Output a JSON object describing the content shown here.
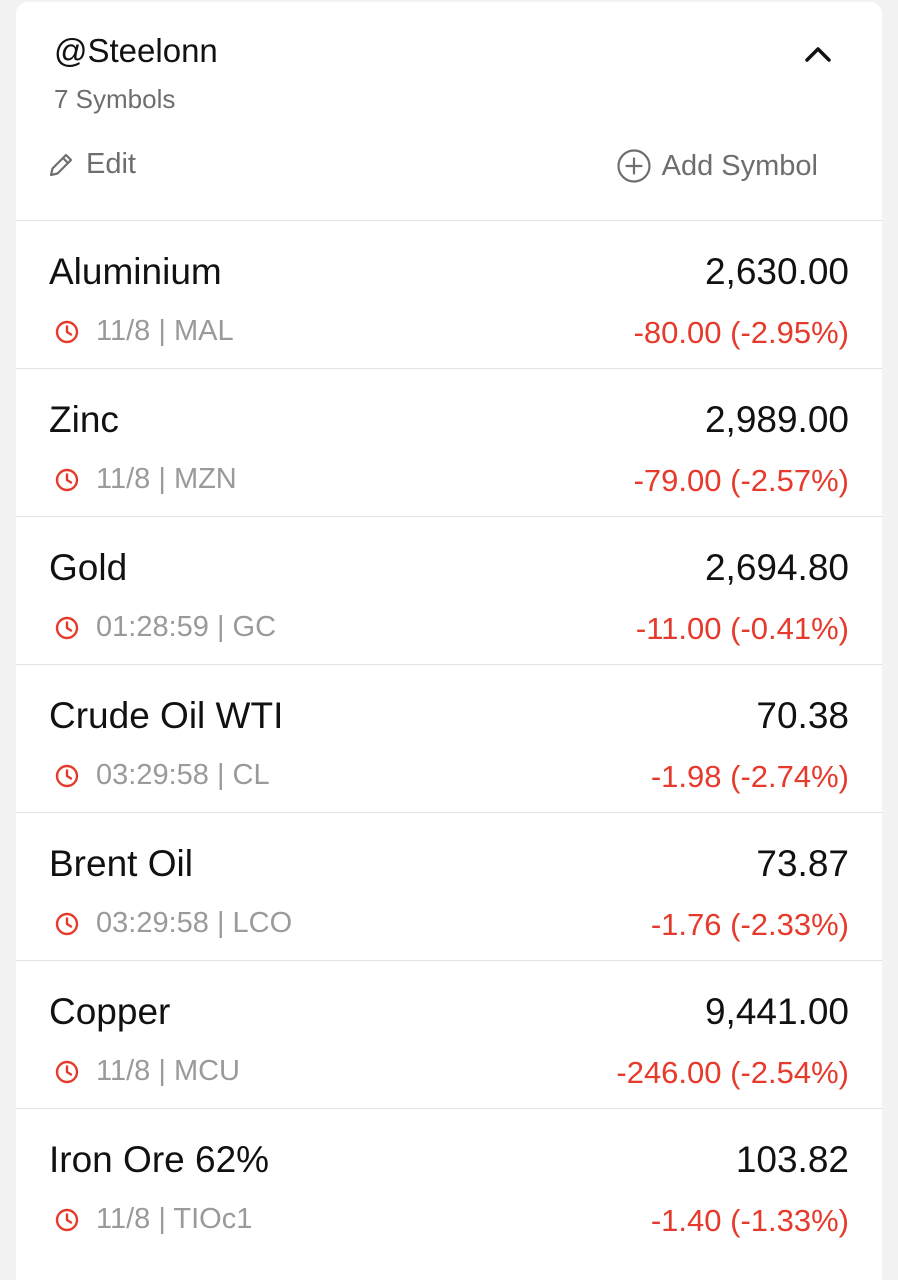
{
  "watchlist": {
    "title": "@Steelonn",
    "count_label": "7 Symbols",
    "edit_label": "Edit",
    "add_label": "Add Symbol"
  },
  "colors": {
    "negative": "#e53a2c",
    "muted": "#9a9a9a",
    "text": "#111111"
  },
  "icons": {
    "collapse": "chevron-up-icon",
    "edit": "pencil-icon",
    "add": "plus-circle-icon",
    "time": "clock-icon"
  },
  "symbols": [
    {
      "name": "Aluminium",
      "price": "2,630.00",
      "time": "11/8",
      "ticker": "MAL",
      "change": "-80.00 (-2.95%)"
    },
    {
      "name": "Zinc",
      "price": "2,989.00",
      "time": "11/8",
      "ticker": "MZN",
      "change": "-79.00 (-2.57%)"
    },
    {
      "name": "Gold",
      "price": "2,694.80",
      "time": "01:28:59",
      "ticker": "GC",
      "change": "-11.00 (-0.41%)"
    },
    {
      "name": "Crude Oil WTI",
      "price": "70.38",
      "time": "03:29:58",
      "ticker": "CL",
      "change": "-1.98 (-2.74%)"
    },
    {
      "name": "Brent Oil",
      "price": "73.87",
      "time": "03:29:58",
      "ticker": "LCO",
      "change": "-1.76 (-2.33%)"
    },
    {
      "name": "Copper",
      "price": "9,441.00",
      "time": "11/8",
      "ticker": "MCU",
      "change": "-246.00 (-2.54%)"
    },
    {
      "name": "Iron Ore 62%",
      "price": "103.82",
      "time": "11/8",
      "ticker": "TIOc1",
      "change": "-1.40 (-1.33%)"
    }
  ]
}
